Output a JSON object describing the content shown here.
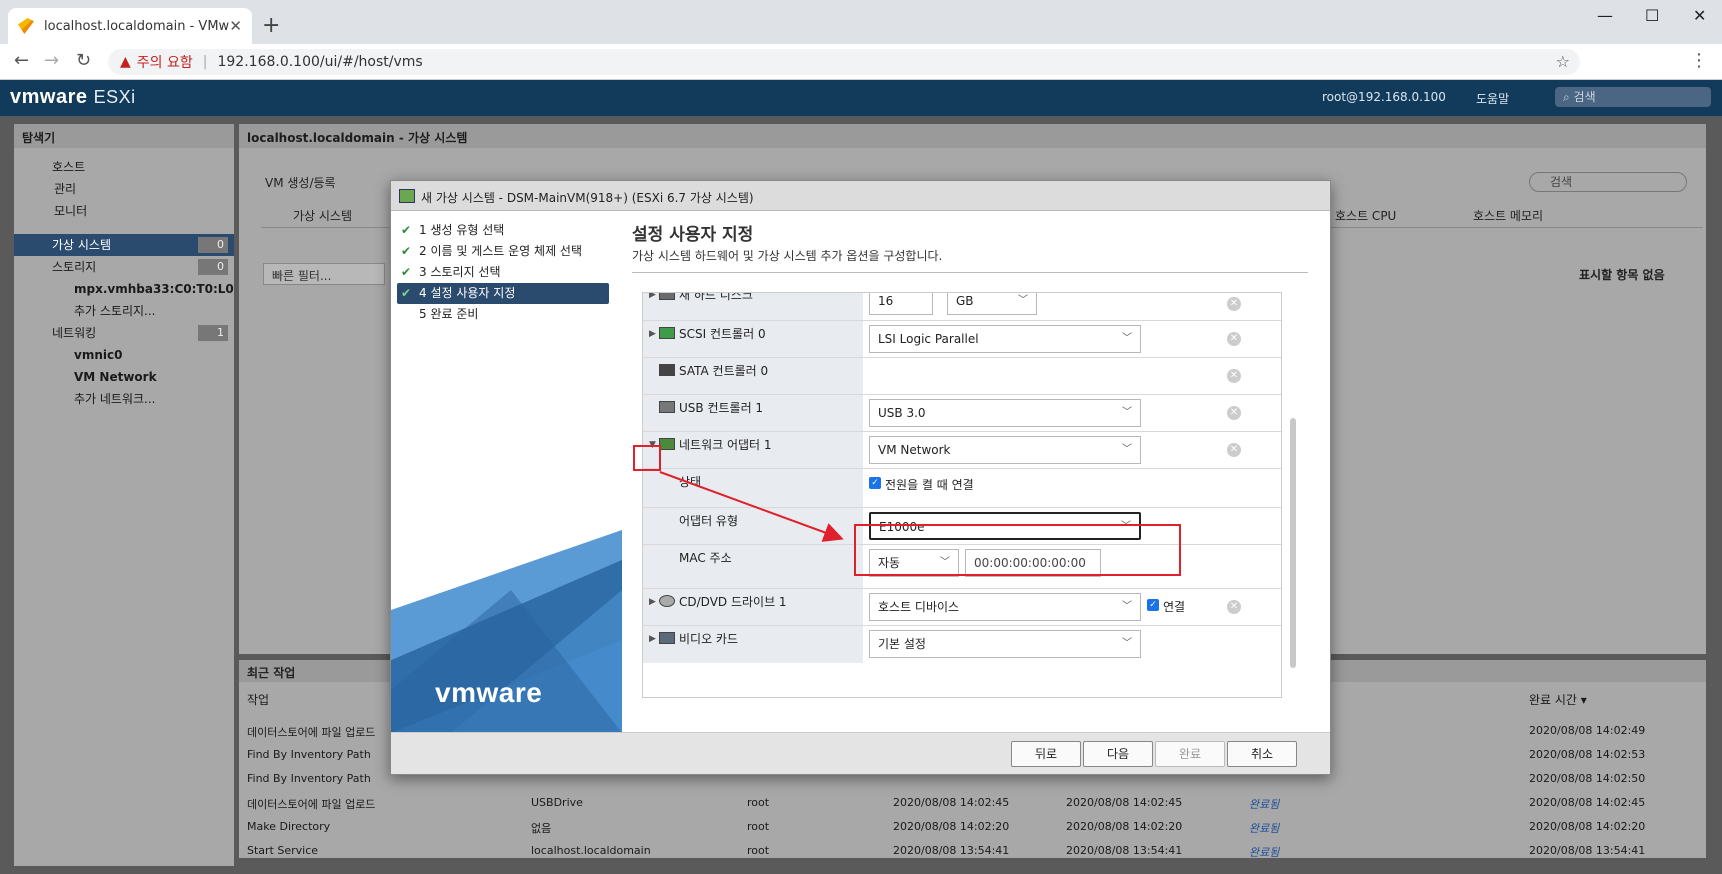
{
  "browser": {
    "tab_title": "localhost.localdomain - VMware",
    "warning_label": "주의 요함",
    "url": "192.168.0.100/ui/#/host/vms"
  },
  "header": {
    "brand": "vmware",
    "product": "ESXi",
    "user": "root@192.168.0.100",
    "help": "도움말",
    "search_placeholder": "검색"
  },
  "navigator": {
    "title": "탐색기",
    "items": [
      {
        "label": "호스트",
        "count": ""
      },
      {
        "label": "관리",
        "count": ""
      },
      {
        "label": "모니터",
        "count": ""
      },
      {
        "label": "가상 시스템",
        "count": "0"
      },
      {
        "label": "스토리지",
        "count": "0"
      },
      {
        "label": "mpx.vmhba33:C0:T0:L0",
        "count": ""
      },
      {
        "label": "추가 스토리지...",
        "count": ""
      },
      {
        "label": "네트워킹",
        "count": "1"
      },
      {
        "label": "vmnic0",
        "count": ""
      },
      {
        "label": "VM Network",
        "count": ""
      },
      {
        "label": "추가 네트워크...",
        "count": ""
      }
    ]
  },
  "content": {
    "title": "localhost.localdomain - 가상 시스템",
    "create_vm": "VM 생성/등록",
    "col_vm": "가상 시스템",
    "col_cpu": "호스트 CPU",
    "col_mem": "호스트 메모리",
    "quick_filter": "빠른 필터...",
    "no_items": "표시할 항목 없음",
    "search": "검색"
  },
  "tasks": {
    "title": "최근 작업",
    "col_task": "작업",
    "col_complete": "완료 시간 ▾",
    "rows": [
      {
        "task": "데이터스토어에 파일 업로드",
        "target": "",
        "user": "",
        "queued": "",
        "started": "",
        "result": "",
        "done": "2020/08/08 14:02:49"
      },
      {
        "task": "Find By Inventory Path",
        "target": "",
        "user": "",
        "queued": "",
        "started": "",
        "result": "",
        "done": "2020/08/08 14:02:53"
      },
      {
        "task": "Find By Inventory Path",
        "target": "",
        "user": "",
        "queued": "",
        "started": "",
        "result": "",
        "done": "2020/08/08 14:02:50"
      },
      {
        "task": "데이터스토어에 파일 업로드",
        "target": "USBDrive",
        "user": "root",
        "queued": "2020/08/08 14:02:45",
        "started": "2020/08/08 14:02:45",
        "result": "완료됨",
        "done": "2020/08/08 14:02:45"
      },
      {
        "task": "Make Directory",
        "target": "없음",
        "user": "root",
        "queued": "2020/08/08 14:02:20",
        "started": "2020/08/08 14:02:20",
        "result": "완료됨",
        "done": "2020/08/08 14:02:20"
      },
      {
        "task": "Start Service",
        "target": "localhost.localdomain",
        "user": "root",
        "queued": "2020/08/08 13:54:41",
        "started": "2020/08/08 13:54:41",
        "result": "완료됨",
        "done": "2020/08/08 13:54:41"
      }
    ]
  },
  "wizard": {
    "title": "새 가상 시스템 - DSM-MainVM(918+) (ESXi 6.7 가상 시스템)",
    "steps": [
      {
        "label": "1 생성 유형 선택",
        "done": true
      },
      {
        "label": "2 이름 및 게스트 운영 체제 선택",
        "done": true
      },
      {
        "label": "3 스토리지 선택",
        "done": true
      },
      {
        "label": "4 설정 사용자 지정",
        "done": true
      },
      {
        "label": "5 완료 준비",
        "done": false
      }
    ],
    "logo": "vmware",
    "page_title": "설정 사용자 지정",
    "page_subtitle": "가상 시스템 하드웨어 및 가상 시스템 추가 옵션을 구성합니다.",
    "disk": {
      "label": "새 하드 디스크",
      "size": "16",
      "unit": "GB"
    },
    "scsi": {
      "label": "SCSI 컨트롤러 0",
      "value": "LSI Logic Parallel"
    },
    "sata": {
      "label": "SATA 컨트롤러 0"
    },
    "usb": {
      "label": "USB 컨트롤러 1",
      "value": "USB 3.0"
    },
    "nic": {
      "label": "네트워크 어댑터 1",
      "value": "VM Network",
      "status_label": "상태",
      "connect_label": "전원을 켤 때 연결",
      "adapter_type_label": "어댑터 유형",
      "adapter_type": "E1000e",
      "mac_label": "MAC 주소",
      "mac_mode": "자동",
      "mac_value": "00:00:00:00:00:00"
    },
    "cdrom": {
      "label": "CD/DVD 드라이브 1",
      "value": "호스트 디바이스",
      "connect": "연결"
    },
    "video": {
      "label": "비디오 카드",
      "value": "기본 설정"
    },
    "buttons": {
      "back": "뒤로",
      "next": "다음",
      "finish": "완료",
      "cancel": "취소"
    }
  },
  "colors": {
    "accent": "#2a4a6e",
    "header": "#123a5a",
    "highlight": "#e0202a",
    "check": "#2e8b3a"
  }
}
